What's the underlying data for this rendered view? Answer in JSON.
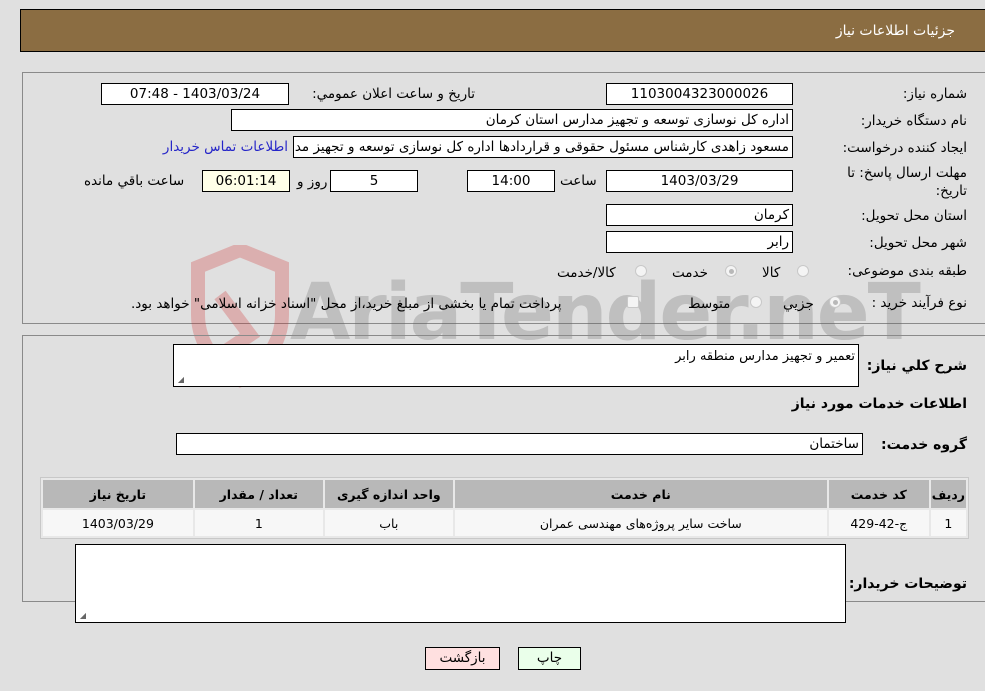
{
  "header": {
    "title": "جزئیات اطلاعات نیاز"
  },
  "fields": {
    "need_number": {
      "label": "شماره نیاز:",
      "value": "1103004323000026"
    },
    "announce_datetime": {
      "label": "تاريخ و ساعت اعلان عمومي:",
      "value": "1403/03/24 - 07:48"
    },
    "buyer_org": {
      "label": "نام دستگاه خریدار:",
      "value": "اداره کل نوسازی  توسعه و تجهیز مدارس استان کرمان"
    },
    "requester": {
      "label": "ایجاد کننده درخواست:",
      "value": "مسعود زاهدی کارشناس مسئول حقوقی و قراردادها اداره کل نوسازی  توسعه و تجهیز مدارس استان کرمان",
      "contact_link": "اطلاعات تماس خریدار"
    },
    "deadline": {
      "label": "مهلت ارسال پاسخ: تا تاریخ:",
      "date": "1403/03/29",
      "time_label": "ساعت",
      "time": "14:00",
      "days": "5",
      "days_label": "روز و",
      "remaining": "06:01:14",
      "remaining_label": "ساعت باقي مانده"
    },
    "province": {
      "label": "استان محل تحویل:",
      "value": "کرمان"
    },
    "city": {
      "label": "شهر محل تحویل:",
      "value": "رابر"
    },
    "category": {
      "label": "طبقه بندی موضوعی:",
      "options": [
        "کالا",
        "خدمت",
        "کالا/خدمت"
      ],
      "selected": "خدمت"
    },
    "purchase_type": {
      "label": "نوع فرآیند خرید :",
      "options": [
        "جزيي",
        "متوسط"
      ],
      "selected": "جزيي",
      "treasury_note": "پرداخت تمام یا بخشی از مبلغ خرید،از محل \"اسناد خزانه اسلامی\" خواهد بود."
    }
  },
  "description": {
    "label": "شرح كلي نياز:",
    "value": "تعمیر و تجهیز مدارس منطقه رابر"
  },
  "services_section": {
    "title": "اطلاعات خدمات مورد نياز"
  },
  "service_group": {
    "label": "گروه خدمت:",
    "value": "ساختمان"
  },
  "services_table": {
    "headers": [
      "ردیف",
      "کد خدمت",
      "نام خدمت",
      "واحد اندازه گیری",
      "تعداد / مقدار",
      "تاریخ نیاز"
    ],
    "rows": [
      [
        "1",
        "ج-42-429",
        "ساخت سایر پروژه‌های مهندسی عمران",
        "باب",
        "1",
        "1403/03/29"
      ]
    ]
  },
  "buyer_notes": {
    "label": "توضیحات خریدار:",
    "value": ""
  },
  "buttons": {
    "print": "چاپ",
    "back": "بازگشت"
  },
  "watermark": {
    "text": "AriaTender.neT"
  },
  "colors": {
    "header_bg": "#8b6d42",
    "print_bg": "#eaffea",
    "back_bg": "#ffe0e0",
    "link": "#2626c8"
  }
}
